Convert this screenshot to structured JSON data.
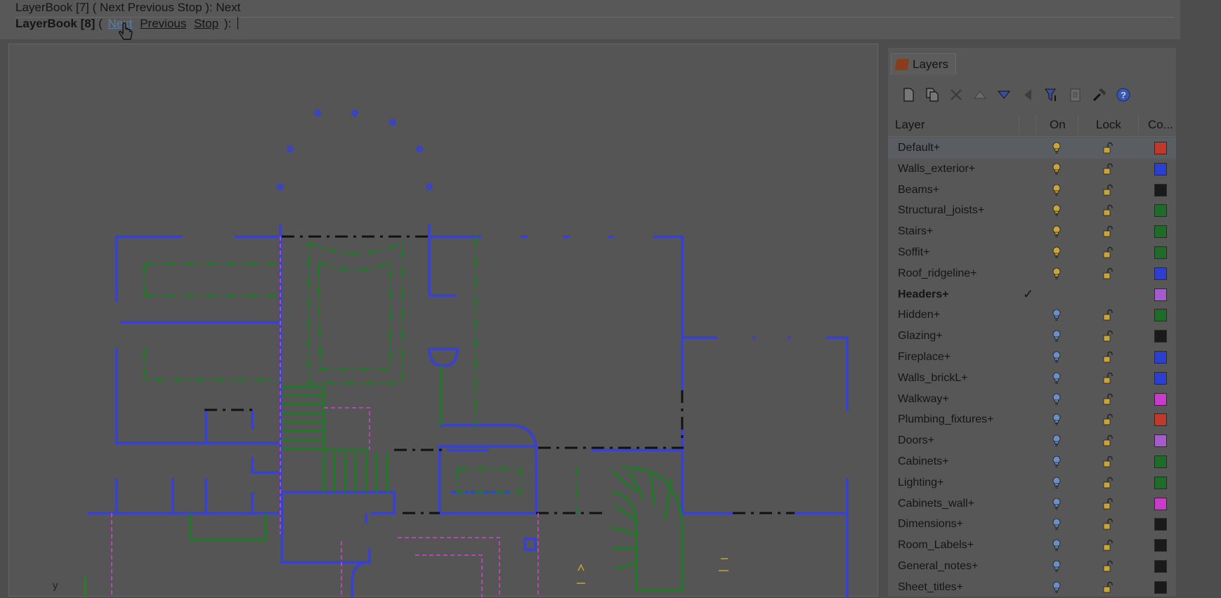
{
  "command": {
    "history_line": "LayerBook [7] ( Next  Previous  Stop ): Next",
    "prompt_prefix": "LayerBook [8]",
    "open_paren": "(",
    "options": [
      "Next",
      "Previous",
      "Stop"
    ],
    "close": "):"
  },
  "viewport": {
    "axis_label": "y"
  },
  "layers_panel": {
    "tab_label": "Layers",
    "toolbar_icons": [
      "new-layer-icon",
      "new-sublayer-icon",
      "delete-icon",
      "move-up-icon",
      "move-down-icon",
      "move-left-icon",
      "filter-icon",
      "clipboard-icon",
      "tools-icon",
      "help-icon"
    ],
    "columns": {
      "layer": "Layer",
      "on": "On",
      "lock": "Lock",
      "color": "Co..."
    },
    "rows": [
      {
        "name": "Default+",
        "bulb": "on",
        "color": "#c0392b"
      },
      {
        "name": "Walls_exterior+",
        "bulb": "on",
        "color": "#2c3fd0"
      },
      {
        "name": "Beams+",
        "bulb": "on",
        "color": "#1a1a1a"
      },
      {
        "name": "Structural_joists+",
        "bulb": "on",
        "color": "#1f6b2a"
      },
      {
        "name": "Stairs+",
        "bulb": "on",
        "color": "#1f6b2a"
      },
      {
        "name": "Soffit+",
        "bulb": "on",
        "color": "#1f6b2a"
      },
      {
        "name": "Roof_ridgeline+",
        "bulb": "on",
        "color": "#2c3fd0"
      },
      {
        "name": "Headers+",
        "bulb": "current",
        "color": "#a35cc9"
      },
      {
        "name": "Hidden+",
        "bulb": "off",
        "color": "#1f6b2a"
      },
      {
        "name": "Glazing+",
        "bulb": "off",
        "color": "#1a1a1a"
      },
      {
        "name": "Fireplace+",
        "bulb": "off",
        "color": "#2c3fd0"
      },
      {
        "name": "Walls_brickL+",
        "bulb": "off",
        "color": "#2c3fd0"
      },
      {
        "name": "Walkway+",
        "bulb": "off",
        "color": "#c93cc9"
      },
      {
        "name": "Plumbing_fixtures+",
        "bulb": "off",
        "color": "#c0392b"
      },
      {
        "name": "Doors+",
        "bulb": "off",
        "color": "#a35cc9"
      },
      {
        "name": "Cabinets+",
        "bulb": "off",
        "color": "#1f6b2a"
      },
      {
        "name": "Lighting+",
        "bulb": "off",
        "color": "#1f6b2a"
      },
      {
        "name": "Cabinets_wall+",
        "bulb": "off",
        "color": "#c93cc9"
      },
      {
        "name": "Dimensions+",
        "bulb": "off",
        "color": "#1a1a1a"
      },
      {
        "name": "Room_Labels+",
        "bulb": "off",
        "color": "#1a1a1a"
      },
      {
        "name": "General_notes+",
        "bulb": "off",
        "color": "#1a1a1a"
      },
      {
        "name": "Sheet_titles+",
        "bulb": "off",
        "color": "#1a1a1a"
      }
    ]
  },
  "colors": {
    "bulb_on": "#c9a43a",
    "bulb_off": "#6a8fc6",
    "lock": "#c9a43a",
    "wall": "#3a42c8",
    "green": "#1f7a25",
    "magenta": "#b04ab0"
  }
}
